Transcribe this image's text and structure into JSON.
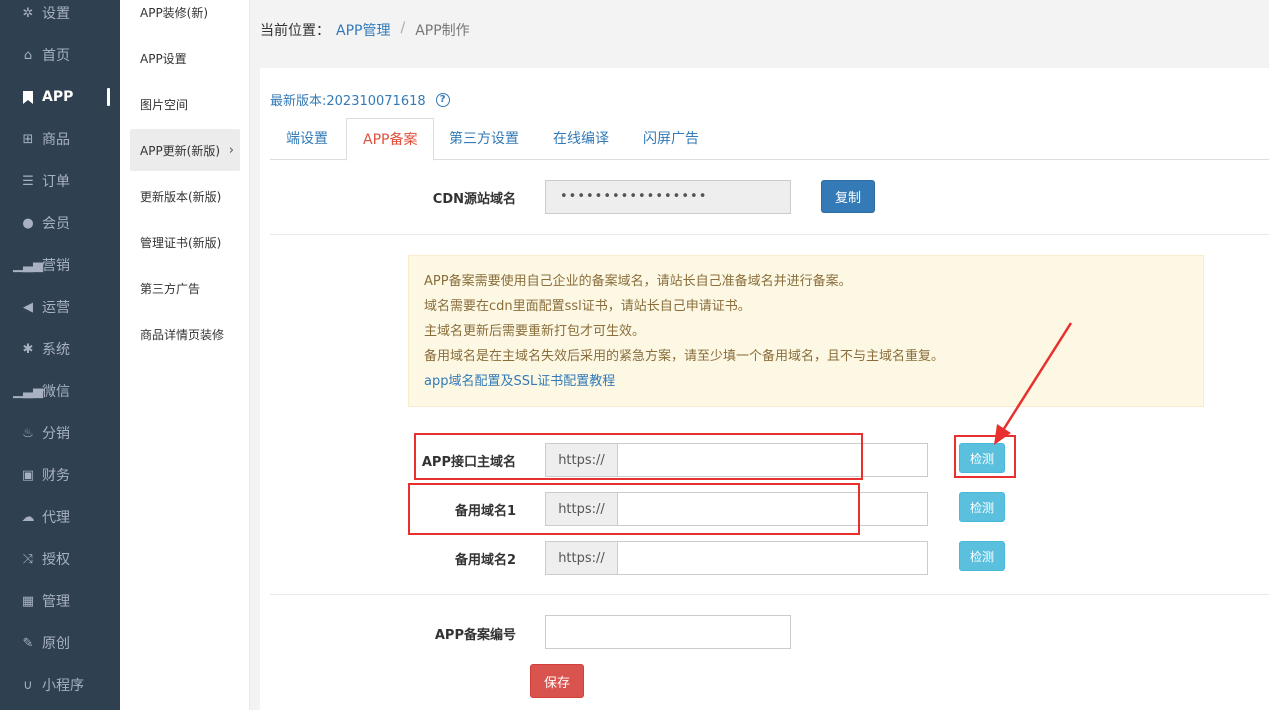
{
  "nav": {
    "items": [
      {
        "label": "设置",
        "icon": "gear-icon"
      },
      {
        "label": "首页",
        "icon": "home-icon"
      },
      {
        "label": "APP",
        "icon": "bookmark-icon"
      },
      {
        "label": "商品",
        "icon": "gift-icon"
      },
      {
        "label": "订单",
        "icon": "list-icon"
      },
      {
        "label": "会员",
        "icon": "user-icon"
      },
      {
        "label": "营销",
        "icon": "signal-icon"
      },
      {
        "label": "运营",
        "icon": "bullhorn-icon"
      },
      {
        "label": "系统",
        "icon": "asterisk-icon"
      },
      {
        "label": "微信",
        "icon": "bars-icon"
      },
      {
        "label": "分销",
        "icon": "fire-icon"
      },
      {
        "label": "财务",
        "icon": "briefcase-icon"
      },
      {
        "label": "代理",
        "icon": "cloud-icon"
      },
      {
        "label": "授权",
        "icon": "random-icon"
      },
      {
        "label": "管理",
        "icon": "grid-icon"
      },
      {
        "label": "原创",
        "icon": "edit-icon"
      },
      {
        "label": "小程序",
        "icon": "magnet-icon"
      }
    ]
  },
  "subnav": {
    "items": [
      {
        "label": "APP装修(新)"
      },
      {
        "label": "APP设置"
      },
      {
        "label": "图片空间"
      },
      {
        "label": "APP更新(新版)"
      },
      {
        "label": "更新版本(新版)"
      },
      {
        "label": "管理证书(新版)"
      },
      {
        "label": "第三方广告"
      },
      {
        "label": "商品详情页装修"
      }
    ]
  },
  "breadcrumb": {
    "prefix": "当前位置：",
    "link": "APP管理",
    "separator": "/",
    "current": "APP制作"
  },
  "version": {
    "text": "最新版本:202310071618",
    "help": "?"
  },
  "tabs": [
    {
      "label": "端设置"
    },
    {
      "label": "APP备案"
    },
    {
      "label": "第三方设置"
    },
    {
      "label": "在线编译"
    },
    {
      "label": "闪屏广告"
    }
  ],
  "cdn": {
    "label": "CDN源站域名",
    "value": "•••••••••••••••••",
    "copy_label": "复制"
  },
  "alert": {
    "lines": [
      "APP备案需要使用自己企业的备案域名，请站长自己准备域名并进行备案。",
      "域名需要在cdn里面配置ssl证书，请站长自己申请证书。",
      "主域名更新后需要重新打包才可生效。",
      "备用域名是在主域名失效后采用的紧急方案，请至少填一个备用域名，且不与主域名重复。"
    ],
    "link": "app域名配置及SSL证书配置教程"
  },
  "domains": [
    {
      "label": "APP接口主域名",
      "prefix": "https://",
      "value": "",
      "check_label": "检测"
    },
    {
      "label": "备用域名1",
      "prefix": "https://",
      "value": "",
      "check_label": "检测"
    },
    {
      "label": "备用域名2",
      "prefix": "https://",
      "value": "",
      "check_label": "检测"
    }
  ],
  "record": {
    "label": "APP备案编号",
    "value": ""
  },
  "save_label": "保存",
  "colors": {
    "nav_bg": "#2f4050",
    "link": "#337ab7",
    "active_tab": "#e04f3c",
    "annotation": "#e8312f",
    "alert_bg": "#fcf8e3"
  }
}
